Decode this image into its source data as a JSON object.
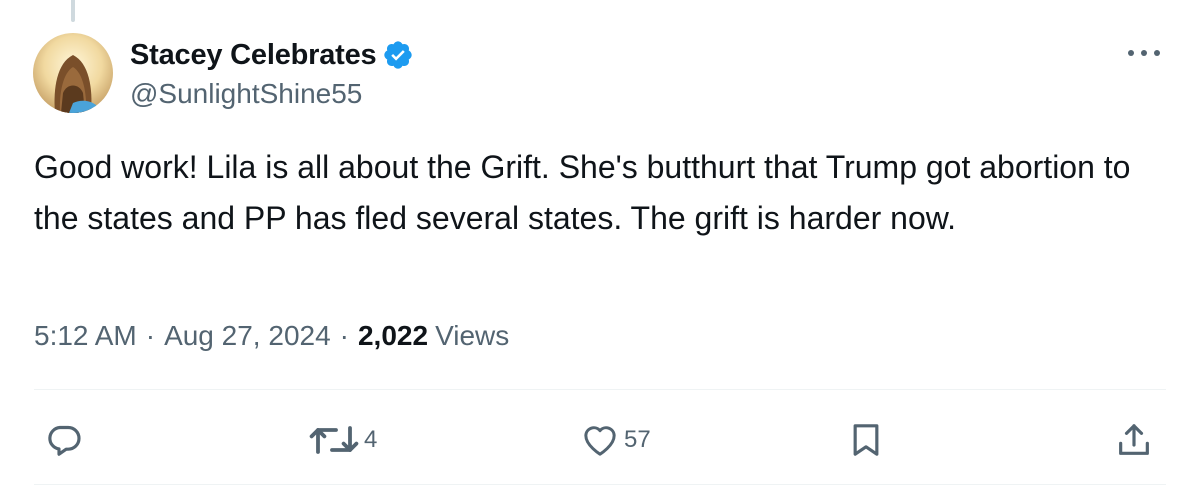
{
  "author": {
    "display_name": "Stacey Celebrates",
    "handle": "@SunlightShine55",
    "verified": true
  },
  "tweet": {
    "text": "Good work! Lila is all about the Grift. She's butthurt that Trump got abortion to the states and PP has fled several states. The grift is harder now."
  },
  "meta": {
    "time": "5:12 AM",
    "separator": "·",
    "date": "Aug 27, 2024",
    "views_count": "2,022",
    "views_label": "Views"
  },
  "actions": {
    "reply_icon": "reply-icon",
    "retweet_icon": "retweet-icon",
    "retweet_count": "4",
    "like_icon": "heart-icon",
    "like_count": "57",
    "bookmark_icon": "bookmark-icon",
    "share_icon": "share-icon"
  },
  "colors": {
    "verified_badge": "#1d9bf0",
    "secondary_text": "#536471",
    "primary_text": "#0f1419",
    "divider": "#eff3f4"
  }
}
